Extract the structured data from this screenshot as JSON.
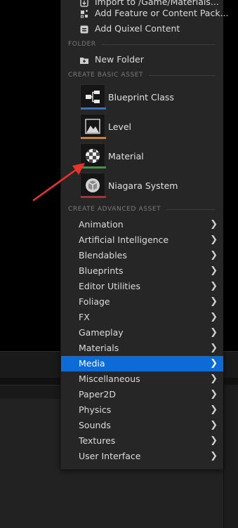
{
  "menu": {
    "top_items": [
      {
        "label": "Import to /Game/Materials...",
        "icon": "import-icon"
      },
      {
        "label": "Add Feature or Content Pack...",
        "icon": "feature-pack-icon"
      },
      {
        "label": "Add Quixel Content",
        "icon": "quixel-icon"
      }
    ],
    "section_folder": "FOLDER",
    "new_folder": {
      "label": "New Folder",
      "icon": "new-folder-icon"
    },
    "section_basic": "CREATE BASIC ASSET",
    "basic_assets": [
      {
        "label": "Blueprint Class",
        "icon": "blueprint-class-icon",
        "accent": "#2f72d6"
      },
      {
        "label": "Level",
        "icon": "level-icon",
        "accent": "#e07a1f"
      },
      {
        "label": "Material",
        "icon": "material-icon",
        "accent": "#3a9a3a"
      },
      {
        "label": "Niagara System",
        "icon": "niagara-system-icon",
        "accent": "#c0262b"
      }
    ],
    "section_advanced": "CREATE ADVANCED ASSET",
    "advanced_items": [
      {
        "label": "Animation"
      },
      {
        "label": "Artificial Intelligence"
      },
      {
        "label": "Blendables"
      },
      {
        "label": "Blueprints"
      },
      {
        "label": "Editor Utilities"
      },
      {
        "label": "Foliage"
      },
      {
        "label": "FX"
      },
      {
        "label": "Gameplay"
      },
      {
        "label": "Materials"
      },
      {
        "label": "Media"
      },
      {
        "label": "Miscellaneous"
      },
      {
        "label": "Paper2D"
      },
      {
        "label": "Physics"
      },
      {
        "label": "Sounds"
      },
      {
        "label": "Textures"
      },
      {
        "label": "User Interface"
      }
    ],
    "active_item": "Media",
    "highlight_color": "#0d6bd8"
  },
  "annotation": {
    "color": "#e8332a",
    "points_to": "Material"
  }
}
